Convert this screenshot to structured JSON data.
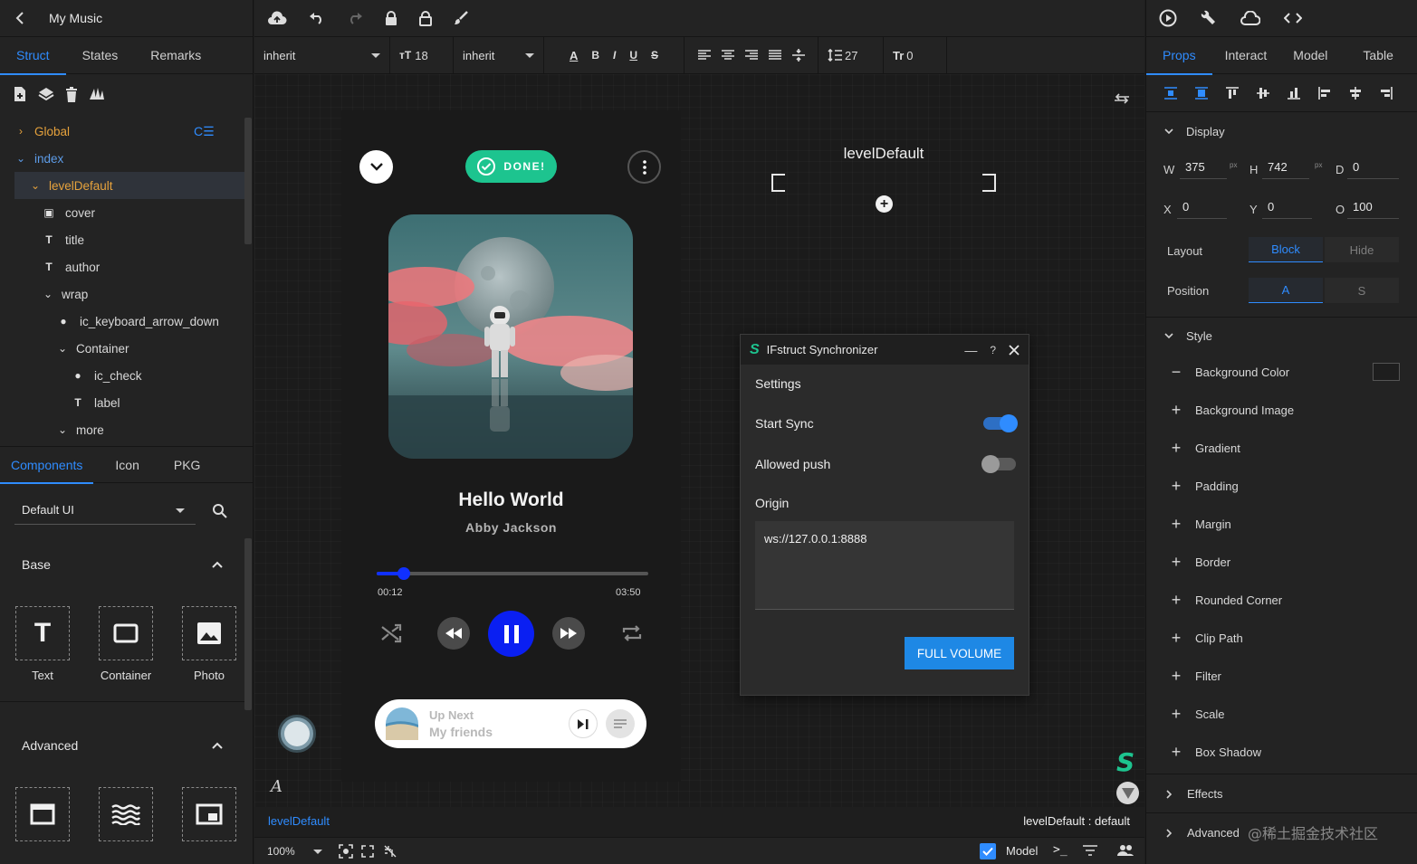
{
  "left": {
    "title": "My Music",
    "tabs": [
      {
        "label": "Struct"
      },
      {
        "label": "States"
      },
      {
        "label": "Remarks"
      }
    ],
    "tree": [
      {
        "label": "Global"
      },
      {
        "label": "index"
      },
      {
        "label": "levelDefault"
      },
      {
        "label": "cover"
      },
      {
        "label": "title"
      },
      {
        "label": "author"
      },
      {
        "label": "wrap"
      },
      {
        "label": "ic_keyboard_arrow_down"
      },
      {
        "label": "Container"
      },
      {
        "label": "ic_check"
      },
      {
        "label": "label"
      },
      {
        "label": "more"
      }
    ],
    "comp_tabs": [
      {
        "label": "Components"
      },
      {
        "label": "Icon"
      },
      {
        "label": "PKG"
      }
    ],
    "library": "Default UI",
    "base_title": "Base",
    "base_items": [
      {
        "label": "Text"
      },
      {
        "label": "Container"
      },
      {
        "label": "Photo"
      }
    ],
    "advanced_title": "Advanced"
  },
  "toolbar": {
    "font_family": "inherit",
    "font_size": "18",
    "font_weight": "inherit",
    "line_height": "27",
    "letter_spacing": "0",
    "bold": "B",
    "italic": "I",
    "underline": "U",
    "strike": "S"
  },
  "canvas": {
    "selected_label": "levelDefault",
    "cursor_letter": "A"
  },
  "phone": {
    "done_label": "DONE!",
    "song_title": "Hello World",
    "song_author": "Abby Jackson",
    "progress": 0.1,
    "time_current": "00:12",
    "time_total": "03:50",
    "up_next_label": "Up Next",
    "up_next_song": "My friends"
  },
  "dialog": {
    "title": "IFstruct Synchronizer",
    "help": "?",
    "settings_label": "Settings",
    "start_sync_label": "Start Sync",
    "start_sync_on": true,
    "allowed_push_label": "Allowed push",
    "allowed_push_on": false,
    "origin_label": "Origin",
    "origin_value": "ws://127.0.0.1:8888",
    "full_volume_label": "FULL VOLUME"
  },
  "right": {
    "tabs": [
      {
        "label": "Props"
      },
      {
        "label": "Interact"
      },
      {
        "label": "Model"
      },
      {
        "label": "Table"
      }
    ],
    "display_title": "Display",
    "w_label": "W",
    "w_value": "375",
    "w_unit": "px",
    "h_label": "H",
    "h_value": "742",
    "h_unit": "px",
    "d_label": "D",
    "d_value": "0",
    "x_label": "X",
    "x_value": "0",
    "y_label": "Y",
    "y_value": "0",
    "o_label": "O",
    "o_value": "100",
    "layout_label": "Layout",
    "layout_block": "Block",
    "layout_hide": "Hide",
    "position_label": "Position",
    "position_a": "A",
    "position_s": "S",
    "style_title": "Style",
    "style_items": [
      {
        "label": "Background Color"
      },
      {
        "label": "Background Image"
      },
      {
        "label": "Gradient"
      },
      {
        "label": "Padding"
      },
      {
        "label": "Margin"
      },
      {
        "label": "Border"
      },
      {
        "label": "Rounded Corner"
      },
      {
        "label": "Clip Path"
      },
      {
        "label": "Filter"
      },
      {
        "label": "Scale"
      },
      {
        "label": "Box Shadow"
      }
    ],
    "effects_title": "Effects",
    "advanced_title": "Advanced",
    "watermark": "@稀土掘金技术社区"
  },
  "status": {
    "breadcrumb": "levelDefault",
    "state": "levelDefault : default",
    "zoom": "100%",
    "model_label": "Model",
    "terminal": ">_"
  },
  "colors": {
    "accent": "#2f8cff",
    "done_green": "#1dc48f",
    "play_blue": "#0a1ff2",
    "dialog_button": "#1e88e5"
  }
}
